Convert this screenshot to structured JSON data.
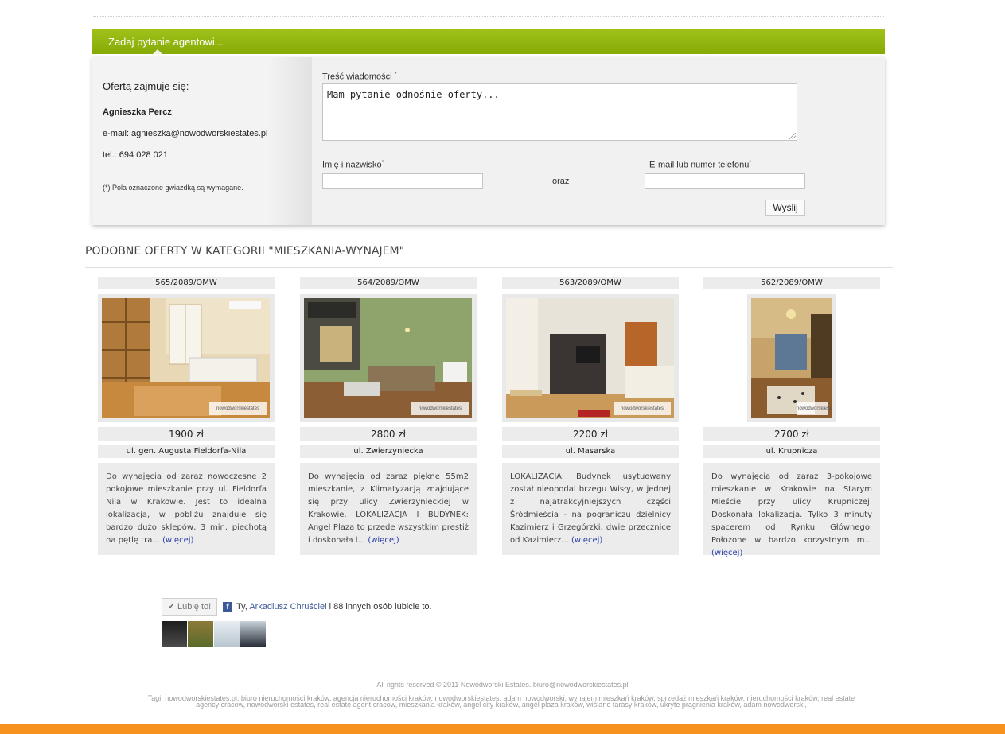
{
  "agent": {
    "header": "Zadaj pytanie agentowi...",
    "handled_by": "Ofertą zajmuje się:",
    "name": "Agnieszka Percz",
    "email": "e-mail: agnieszka@nowodworskiestates.pl",
    "tel": "tel.: 694 028 021",
    "required_note": "(*) Pola oznaczone gwiazdką są wymagane."
  },
  "form": {
    "message_label": "Treść wiadomości",
    "message_value": "Mam pytanie odnośnie oferty...",
    "name_label": "Imię i nazwisko",
    "contact_label": "E-mail lub numer telefonu",
    "oraz": "oraz",
    "send": "Wyślij",
    "asterisk": "*"
  },
  "similar": {
    "title": "PODOBNE OFERTY W KATEGORII \"MIESZKANIA-WYNAJEM\"",
    "more_label": "(więcej)",
    "offers": [
      {
        "code": "565/2089/OMW",
        "price": "1900 zł",
        "street": "ul. gen. Augusta Fieldorfa-Nila",
        "desc": "Do wynajęcia od zaraz nowoczesne 2 pokojowe mieszkanie przy ul. Fieldorfa Nila w Krakowie. Jest to idealna lokalizacja, w pobliżu znajduje się bardzo dużo sklepów, 3 min. piechotą na pętlę tra...",
        "logo": "nowodworskiestates"
      },
      {
        "code": "564/2089/OMW",
        "price": "2800 zł",
        "street": "ul. Zwierzyniecka",
        "desc": "Do wynajęcia od zaraz piękne 55m2 mieszkanie, z Klimatyzacją znajdujące się przy ulicy Zwierzynieckiej w Krakowie. LOKALIZACJA I BUDYNEK: Angel Plaza to przede wszystkim prestiż i doskonała l...",
        "logo": "nowodworskiestates"
      },
      {
        "code": "563/2089/OMW",
        "price": "2200 zł",
        "street": "ul. Masarska",
        "desc": "LOKALIZACJA: Budynek usytuowany został nieopodal brzegu Wisły, w jednej z najatrakcyjniejszych części Śródmieścia - na pograniczu dzielnicy Kazimierz i Grzegórzki, dwie przecznice od Kazimierz...",
        "logo": "nowodworskiestates"
      },
      {
        "code": "562/2089/OMW",
        "price": "2700 zł",
        "street": "ul. Krupnicza",
        "desc": "Do wynajęcia od zaraz 3-pokojowe mieszkanie w Krakowie na Starym Mieście przy ulicy Krupniczej. Doskonała lokalizacja. Tylko 3 minuty spacerem od Rynku Głównego. Położone w bardzo korzystnym m...",
        "logo": "nowodworskiestates"
      }
    ]
  },
  "facebook": {
    "like_label": "✔ Lubię to!",
    "icon": "f",
    "text_prefix": "Ty,",
    "friend": "Arkadiusz Chruściel",
    "text_suffix": "i 88 innych osób lubicie to."
  },
  "footer": {
    "copyright": "All rights reserved © 2011 Nowodworski Estates.   biuro@nowodworskiestates.pl",
    "tags": "Tagi: nowodworskiestates.pl, biuro nieruchomości kraków, agencja nieruchomości kraków, nowodworskiestates, adam nowodworski, wynajem mieszkań kraków, sprzedaż mieszkań kraków, nieruchomości kraków, real estate agency cracow, nowodworski estates, real estate agent cracow, mieszkania kraków, angel city kraków, angel plaza kraków, wiślane tarasy kraków, ukryte pragnienia kraków, adam nowodworski,"
  },
  "colors": {
    "header_green": "#8cb00d",
    "orange_bar": "#f7921e",
    "link_blue": "#2a3da6"
  }
}
